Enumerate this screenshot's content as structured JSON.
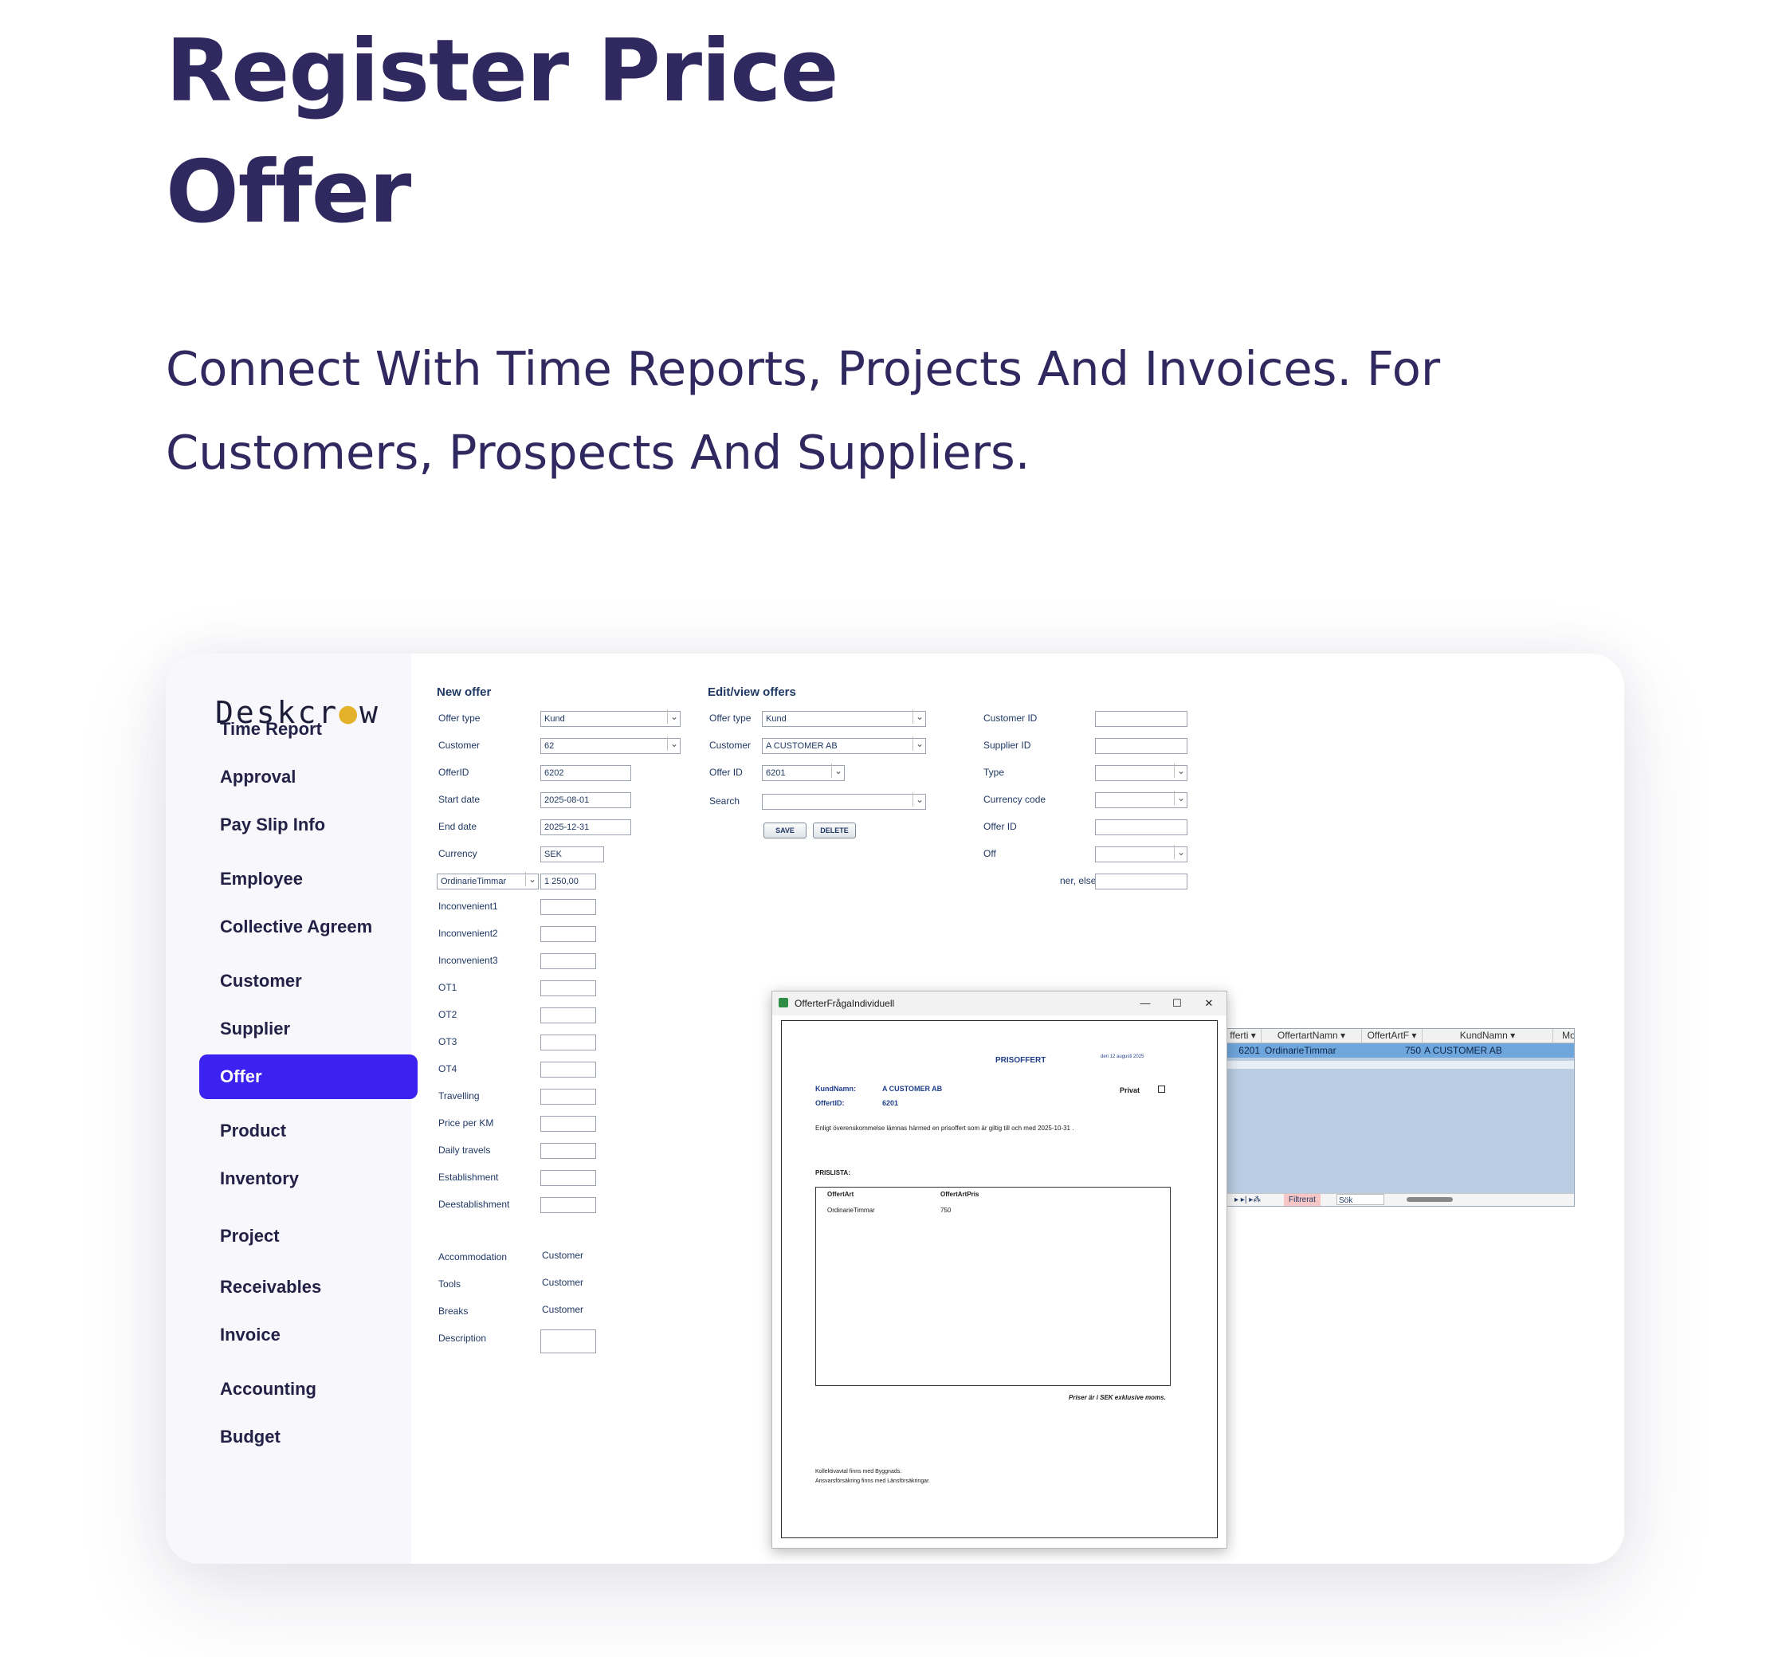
{
  "hero": {
    "title_line1": "Register Price",
    "title_line2": "Offer",
    "subtitle_line1": "Connect With Time Reports, Projects And Invoices. For",
    "subtitle_line2": "Customers, Prospects And Suppliers."
  },
  "brand": {
    "logo": "Deskcr",
    "logo_dot": "●",
    "logo_end": "w"
  },
  "sidebar": {
    "items": [
      {
        "label": "Time Report"
      },
      {
        "label": "Approval"
      },
      {
        "label": "Pay Slip Info"
      },
      {
        "label": "Employee"
      },
      {
        "label": "Collective Agreem"
      },
      {
        "label": "Customer"
      },
      {
        "label": "Supplier"
      },
      {
        "label": "Offer",
        "active": true
      },
      {
        "label": "Product"
      },
      {
        "label": "Inventory"
      },
      {
        "label": "Project"
      },
      {
        "label": "Receivables"
      },
      {
        "label": "Invoice"
      },
      {
        "label": "Accounting"
      },
      {
        "label": "Budget"
      }
    ],
    "active_color": "#3b22f0"
  },
  "new_offer": {
    "title": "New offer",
    "offer_type_label": "Offer type",
    "offer_type_value": "Kund",
    "customer_label": "Customer",
    "customer_value": "62",
    "offer_id_label": "OfferID",
    "offer_id_value": "6202",
    "start_date_label": "Start date",
    "start_date_value": "2025-08-01",
    "end_date_label": "End date",
    "end_date_value": "2025-12-31",
    "currency_label": "Currency",
    "currency_value": "SEK",
    "article_select": "OrdinarieTimmar",
    "article_value": "1 250,00",
    "rows": [
      "Inconvenient1",
      "Inconvenient2",
      "Inconvenient3",
      "OT1",
      "OT2",
      "OT3",
      "OT4",
      "Travelling",
      "Price per KM",
      "Daily travels",
      "Establishment",
      "Deestablishment"
    ],
    "accommodation_label": "Accommodation",
    "accommodation_value": "Customer",
    "tools_label": "Tools",
    "tools_value": "Customer",
    "breaks_label": "Breaks",
    "breaks_value": "Customer",
    "description_label": "Description"
  },
  "edit_offers": {
    "title": "Edit/view offers",
    "offer_type_label": "Offer type",
    "offer_type_value": "Kund",
    "customer_label": "Customer",
    "customer_value": "A CUSTOMER AB",
    "offer_id_label": "Offer ID",
    "offer_id_value": "6201",
    "search_label": "Search",
    "save_button": "SAVE",
    "delete_button": "DELETE"
  },
  "filters": {
    "customer_id_label": "Customer ID",
    "supplier_id_label": "Supplier ID",
    "type_label": "Type",
    "currency_code_label": "Currency code",
    "offer_id_label": "Offer ID",
    "offer_partial": "Off",
    "else_partial": "ner, else"
  },
  "grid": {
    "headers": [
      "fferti ▾",
      "OffertartNamn ▾",
      "OffertArtF ▾",
      "KundNamn ▾",
      "Mo"
    ],
    "row": {
      "id": "6201",
      "name": "OrdinarieTimmar",
      "price": "750",
      "customer": "A CUSTOMER AB"
    },
    "nav": "▸ ▸| ▸⁂",
    "filter_label": "Filtrerat",
    "search_label": "Sök"
  },
  "dialog": {
    "title": "OfferterFrågaIndividuell",
    "minimize": "—",
    "maximize": "☐",
    "close": "✕",
    "doc_title": "PRISOFFERT",
    "doc_date": "den 12 augusti 2025",
    "kundnamn_label": "KundNamn:",
    "kundnamn_value": "A CUSTOMER AB",
    "offertid_label": "OffertID:",
    "offertid_value": "6201",
    "privat_label": "Privat",
    "intro_text": "Enligt överenskommelse lämnas härmed en prisoffert som är giltig till och med  2025-10-31 .",
    "prislista_label": "PRISLISTA:",
    "col_art": "OffertArt",
    "col_price": "OffertArtPris",
    "row_art": "OrdinarieTimmar",
    "row_price": "750",
    "footer_note": "Priser är i   SEK   exklusive moms.",
    "note1": "Kollektivavtal finns med Byggnads.",
    "note2": "Ansvarsförsäkring finns med Länsförsäkringar."
  }
}
